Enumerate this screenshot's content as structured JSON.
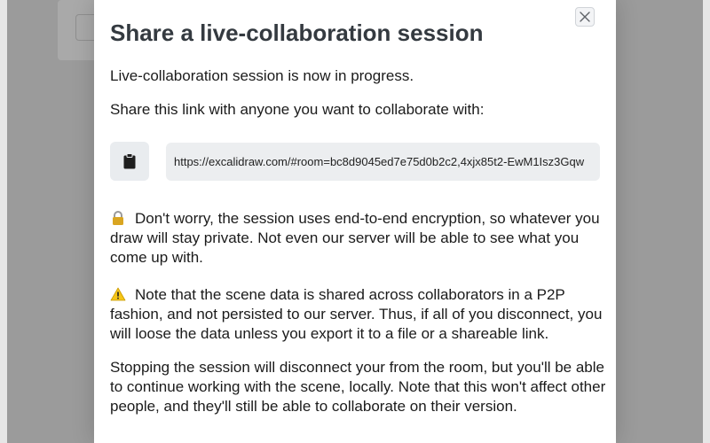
{
  "dialog": {
    "title": "Share a live-collaboration session",
    "status_text": "Live-collaboration session is now in progress.",
    "share_instruction": "Share this link with anyone you want to collaborate with:",
    "link_value": "https://excalidraw.com/#room=bc8d9045ed7e75d0b2c2,4xjx85t2-EwM1Isz3Gqw",
    "encryption_note": "Don't worry, the session uses end-to-end encryption, so whatever you draw will stay private. Not even our server will be able to see what you come up with.",
    "p2p_warning": "Note that the scene data is shared across collaborators in a P2P fashion, and not persisted to our server. Thus, if all of you disconnect, you will loose the data unless you export it to a file or a shareable link.",
    "stop_note": "Stopping the session will disconnect your from the room, but you'll be able to continue working with the scene, locally. Note that this won't affect other people, and they'll still be able to collaborate on their version."
  },
  "icons": {
    "close": "close-icon",
    "copy": "clipboard-icon",
    "lock": "lock-icon",
    "warning": "warning-icon"
  },
  "colors": {
    "overlay": "#9b9b9b",
    "dialog_bg": "#ffffff",
    "title": "#343a40",
    "text": "#1b1b1b",
    "input_bg": "#eceef0",
    "copy_button_bg": "#e9ecef",
    "warning": "#f5c518"
  }
}
